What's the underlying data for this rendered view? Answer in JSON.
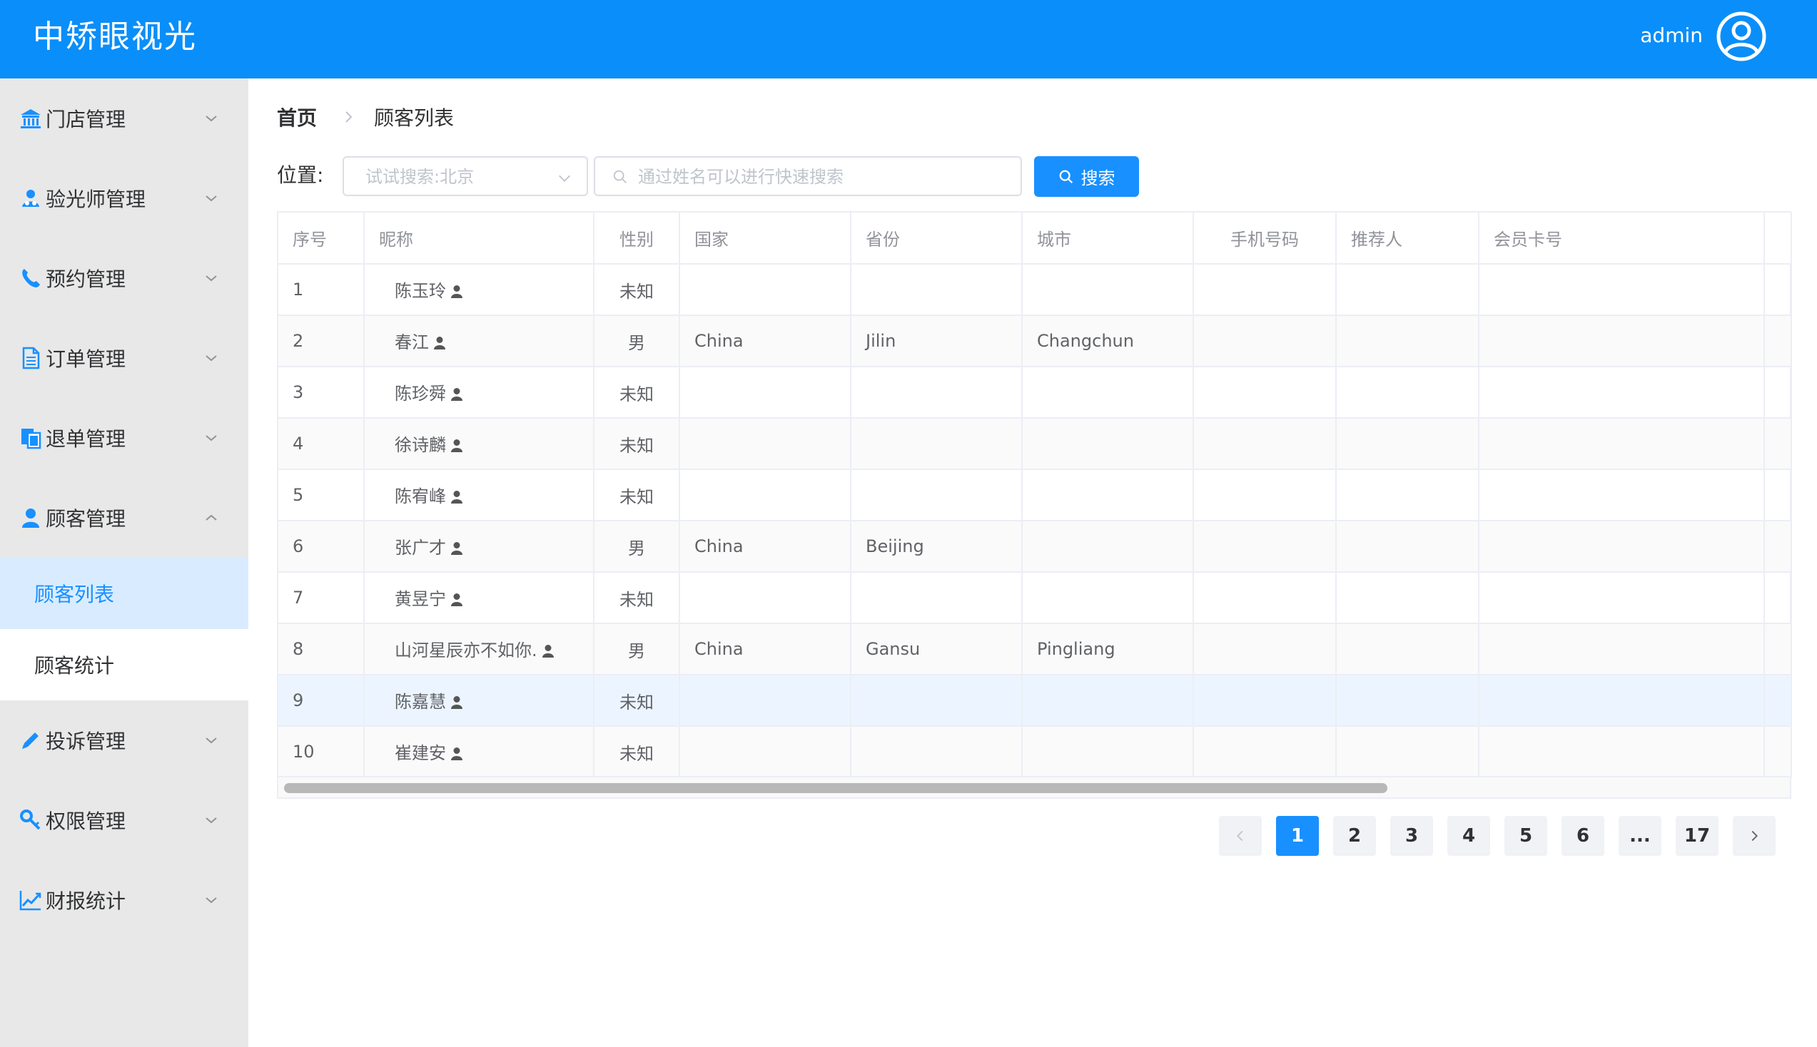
{
  "header": {
    "app_title": "中矫眼视光",
    "user_name": "admin"
  },
  "sidebar": {
    "menus": [
      {
        "label": "门店管理",
        "icon": "bank-icon"
      },
      {
        "label": "验光师管理",
        "icon": "user-group-icon"
      },
      {
        "label": "预约管理",
        "icon": "phone-icon"
      },
      {
        "label": "订单管理",
        "icon": "document-icon"
      },
      {
        "label": "退单管理",
        "icon": "copy-icon"
      },
      {
        "label": "顾客管理",
        "icon": "user-icon",
        "expanded": true
      },
      {
        "label": "投诉管理",
        "icon": "pencil-icon"
      },
      {
        "label": "权限管理",
        "icon": "key-icon"
      },
      {
        "label": "财报统计",
        "icon": "line-chart-icon"
      }
    ],
    "submenu": [
      {
        "label": "顾客列表",
        "active": true
      },
      {
        "label": "顾客统计",
        "active": false
      }
    ]
  },
  "breadcrumb": {
    "home": "首页",
    "current": "顾客列表"
  },
  "filter": {
    "location_label": "位置:",
    "location_placeholder": "试试搜索:北京",
    "search_placeholder": "通过姓名可以进行快速搜索",
    "search_button": "搜索"
  },
  "table": {
    "columns": [
      "序号",
      "昵称",
      "性别",
      "国家",
      "省份",
      "城市",
      "手机号码",
      "推荐人",
      "会员卡号"
    ],
    "rows": [
      {
        "index": "1",
        "nickname": "陈玉玲",
        "gender": "未知",
        "country": "",
        "province": "",
        "city": "",
        "phone": "",
        "referrer": "",
        "card": ""
      },
      {
        "index": "2",
        "nickname": "春江",
        "gender": "男",
        "country": "China",
        "province": "Jilin",
        "city": "Changchun",
        "phone": "",
        "referrer": "",
        "card": ""
      },
      {
        "index": "3",
        "nickname": "陈珍舜",
        "gender": "未知",
        "country": "",
        "province": "",
        "city": "",
        "phone": "",
        "referrer": "",
        "card": ""
      },
      {
        "index": "4",
        "nickname": "徐诗麟",
        "gender": "未知",
        "country": "",
        "province": "",
        "city": "",
        "phone": "",
        "referrer": "",
        "card": ""
      },
      {
        "index": "5",
        "nickname": "陈宥峰",
        "gender": "未知",
        "country": "",
        "province": "",
        "city": "",
        "phone": "",
        "referrer": "",
        "card": ""
      },
      {
        "index": "6",
        "nickname": "张广才",
        "gender": "男",
        "country": "China",
        "province": "Beijing",
        "city": "",
        "phone": "",
        "referrer": "",
        "card": ""
      },
      {
        "index": "7",
        "nickname": "黄昱宁",
        "gender": "未知",
        "country": "",
        "province": "",
        "city": "",
        "phone": "",
        "referrer": "",
        "card": ""
      },
      {
        "index": "8",
        "nickname": "山河星辰亦不如你.",
        "gender": "男",
        "country": "China",
        "province": "Gansu",
        "city": "Pingliang",
        "phone": "",
        "referrer": "",
        "card": ""
      },
      {
        "index": "9",
        "nickname": "陈嘉慧",
        "gender": "未知",
        "country": "",
        "province": "",
        "city": "",
        "phone": "",
        "referrer": "",
        "card": ""
      },
      {
        "index": "10",
        "nickname": "崔建安",
        "gender": "未知",
        "country": "",
        "province": "",
        "city": "",
        "phone": "",
        "referrer": "",
        "card": ""
      }
    ],
    "hover_row": 9
  },
  "pagination": {
    "pages": [
      "1",
      "2",
      "3",
      "4",
      "5",
      "6",
      "...",
      "17"
    ],
    "current": "1"
  },
  "colors": {
    "primary": "#1890ff",
    "header_bg": "#0a8ef9",
    "sidebar_bg": "#e8e8e8",
    "active_submenu_bg": "#d9ecff"
  }
}
